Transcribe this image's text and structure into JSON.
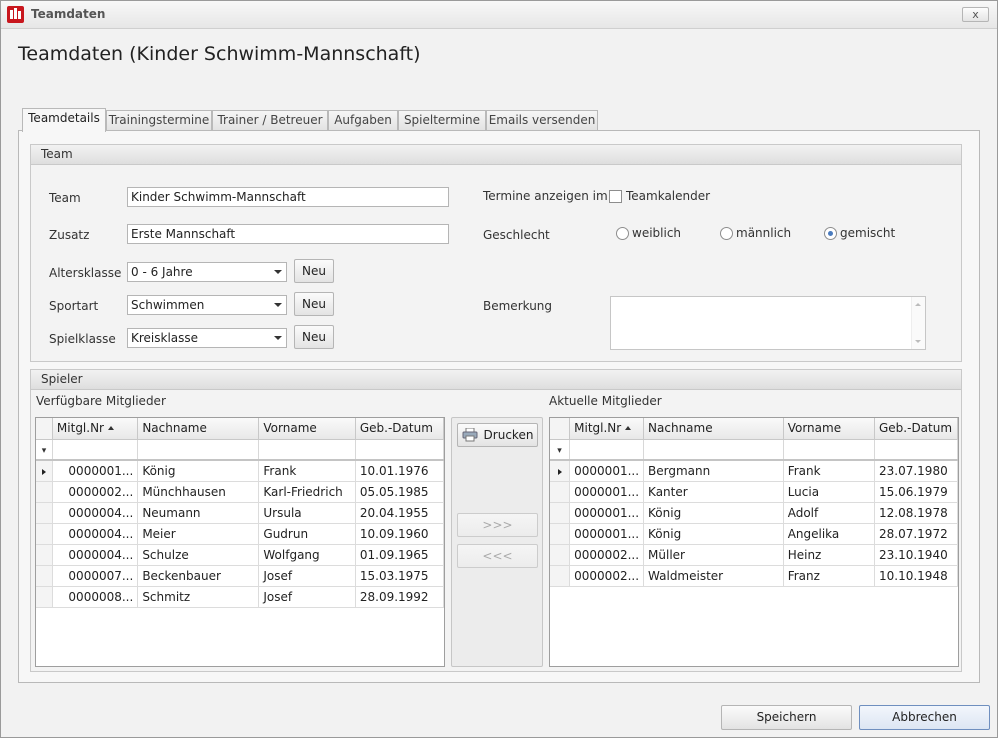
{
  "window": {
    "title": "Teamdaten",
    "close_label": "x"
  },
  "heading": "Teamdaten (Kinder Schwimm-Mannschaft)",
  "tabs": [
    {
      "label": "Teamdetails"
    },
    {
      "label": "Trainingstermine"
    },
    {
      "label": "Trainer / Betreuer"
    },
    {
      "label": "Aufgaben"
    },
    {
      "label": "Spieltermine"
    },
    {
      "label": "Emails versenden"
    }
  ],
  "team_group": {
    "title": "Team",
    "team_label": "Team",
    "team_value": "Kinder Schwimm-Mannschaft",
    "zusatz_label": "Zusatz",
    "zusatz_value": "Erste Mannschaft",
    "altersklasse_label": "Altersklasse",
    "altersklasse_value": "0 - 6 Jahre",
    "sportart_label": "Sportart",
    "sportart_value": "Schwimmen",
    "spielklasse_label": "Spielklasse",
    "spielklasse_value": "Kreisklasse",
    "neu_label": "Neu",
    "termine_label": "Termine anzeigen im",
    "teamkalender_label": "Teamkalender",
    "geschlecht_label": "Geschlecht",
    "geschlecht_options": [
      "weiblich",
      "männlich",
      "gemischt"
    ],
    "geschlecht_selected": "gemischt",
    "bemerkung_label": "Bemerkung",
    "bemerkung_value": ""
  },
  "spieler_group": {
    "title": "Spieler",
    "available_label": "Verfügbare Mitglieder",
    "current_label": "Aktuelle Mitglieder",
    "columns": [
      "Mitgl.Nr",
      "Nachname",
      "Vorname",
      "Geb.-Datum"
    ],
    "available_rows": [
      [
        "0000001...",
        "König",
        "Frank",
        "10.01.1976"
      ],
      [
        "0000002...",
        "Münchhausen",
        "Karl-Friedrich",
        "05.05.1985"
      ],
      [
        "0000004...",
        "Neumann",
        "Ursula",
        "20.04.1955"
      ],
      [
        "0000004...",
        "Meier",
        "Gudrun",
        "10.09.1960"
      ],
      [
        "0000004...",
        "Schulze",
        "Wolfgang",
        "01.09.1965"
      ],
      [
        "0000007...",
        "Beckenbauer",
        "Josef",
        "15.03.1975"
      ],
      [
        "0000008...",
        "Schmitz",
        "Josef",
        "28.09.1992"
      ]
    ],
    "current_rows": [
      [
        "0000001...",
        "Bergmann",
        "Frank",
        "23.07.1980"
      ],
      [
        "0000001...",
        "Kanter",
        "Lucia",
        "15.06.1979"
      ],
      [
        "0000001...",
        "König",
        "Adolf",
        "12.08.1978"
      ],
      [
        "0000001...",
        "König",
        "Angelika",
        "28.07.1972"
      ],
      [
        "0000002...",
        "Müller",
        "Heinz",
        "23.10.1940"
      ],
      [
        "0000002...",
        "Waldmeister",
        "Franz",
        "10.10.1948"
      ]
    ],
    "print_label": "Drucken",
    "move_right_label": ">>>",
    "move_left_label": "<<<"
  },
  "footer": {
    "save_label": "Speichern",
    "cancel_label": "Abbrechen"
  }
}
